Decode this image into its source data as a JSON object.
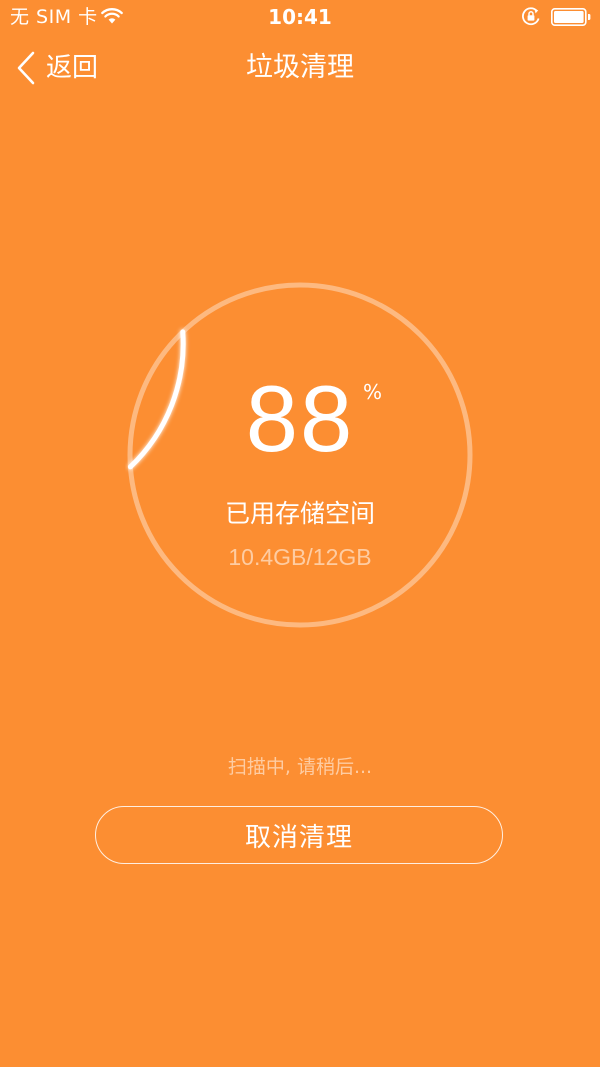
{
  "status_bar": {
    "carrier": "无 SIM 卡",
    "time": "10:41",
    "icons": [
      "wifi-icon",
      "rotation-lock-icon",
      "battery-icon"
    ]
  },
  "nav": {
    "back_label": "返回",
    "title": "垃圾清理"
  },
  "storage": {
    "percent": "88",
    "percent_unit": "%",
    "label": "已用存储空间",
    "detail": "10.4GB/12GB",
    "ring_progress_fraction": 0.14
  },
  "scan": {
    "status": "扫描中, 请稍后..."
  },
  "actions": {
    "cancel_label": "取消清理"
  },
  "colors": {
    "background": "#FC8E32",
    "foreground": "#FFFFFF"
  }
}
